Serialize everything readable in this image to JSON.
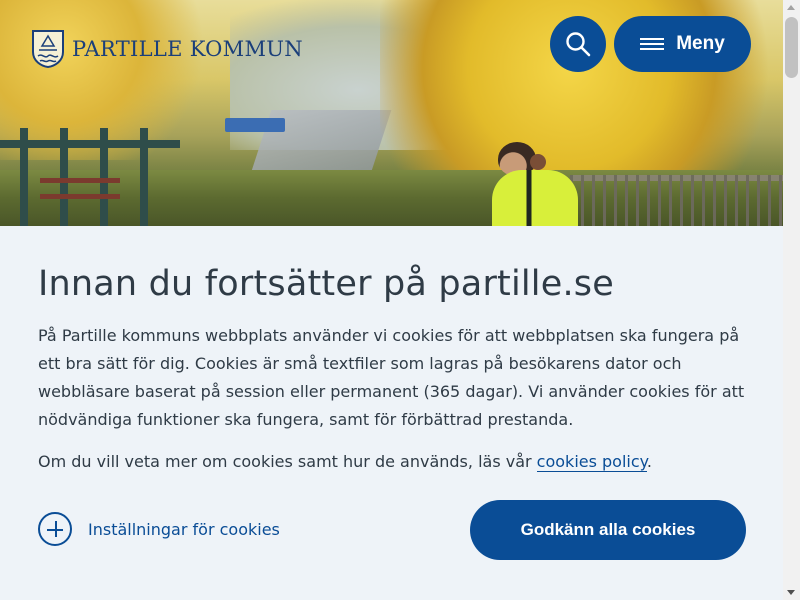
{
  "header": {
    "logo_text": "PARTILLE KOMMUN",
    "logo_icon": "municipal-crest-icon",
    "search_icon": "search-icon",
    "menu_icon": "hamburger-icon",
    "menu_label": "Meny"
  },
  "colors": {
    "brand_blue": "#0a4d96",
    "dialog_background": "#eef3f8",
    "text": "#2f3b46"
  },
  "cookie_dialog": {
    "title": "Innan du fortsätter på partille.se",
    "paragraph1": "På Partille kommuns webbplats använder vi cookies för att webbplatsen ska fungera på ett bra sätt för dig. Cookies är små textfiler som lagras på besökarens dator och webbläsare baserat på session eller permanent (365 dagar). Vi använder cookies för att nödvändiga funktioner ska fungera, samt för förbättrad prestanda.",
    "paragraph2_prefix": "Om du vill veta mer om cookies samt hur de används, läs vår ",
    "policy_link": "cookies policy",
    "paragraph2_suffix": ".",
    "settings_label": "Inställningar för cookies",
    "settings_icon": "plus-circle-icon",
    "accept_label": "Godkänn alla cookies"
  }
}
